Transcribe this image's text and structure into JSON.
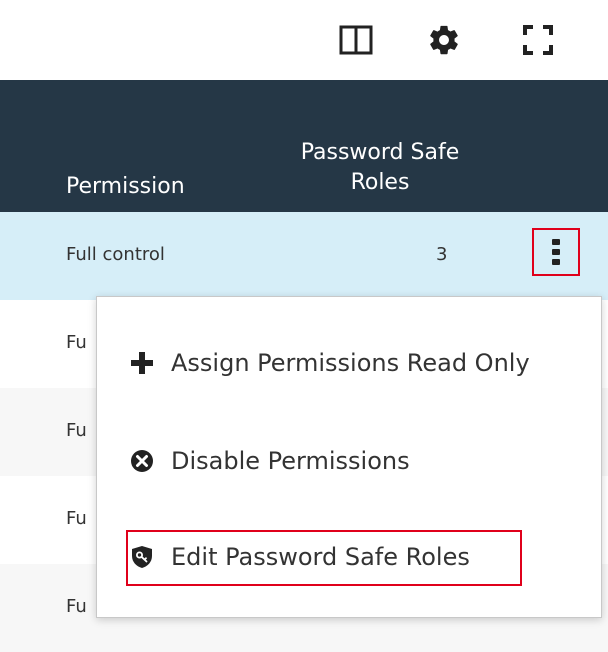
{
  "toolbar": {
    "icons": [
      "columns-icon",
      "gear-icon",
      "fullscreen-icon"
    ]
  },
  "table": {
    "columns": {
      "permission": "Permission",
      "password_safe_roles": "Password Safe Roles"
    },
    "rows": [
      {
        "permission": "Full control",
        "roles": "3"
      },
      {
        "permission": "Fu",
        "roles": ""
      },
      {
        "permission": "Fu",
        "roles": ""
      },
      {
        "permission": "Fu",
        "roles": ""
      },
      {
        "permission": "Fu",
        "roles": ""
      }
    ]
  },
  "context_menu": {
    "items": [
      {
        "label": "Assign Permissions Read Only",
        "icon": "plus-icon"
      },
      {
        "label": "Disable Permissions",
        "icon": "x-circle-icon"
      },
      {
        "label": "Edit Password Safe Roles",
        "icon": "shield-key-icon"
      }
    ]
  },
  "colors": {
    "header_bg": "#253746",
    "selected_row_bg": "#d6eef8",
    "highlight": "#e0001b"
  }
}
